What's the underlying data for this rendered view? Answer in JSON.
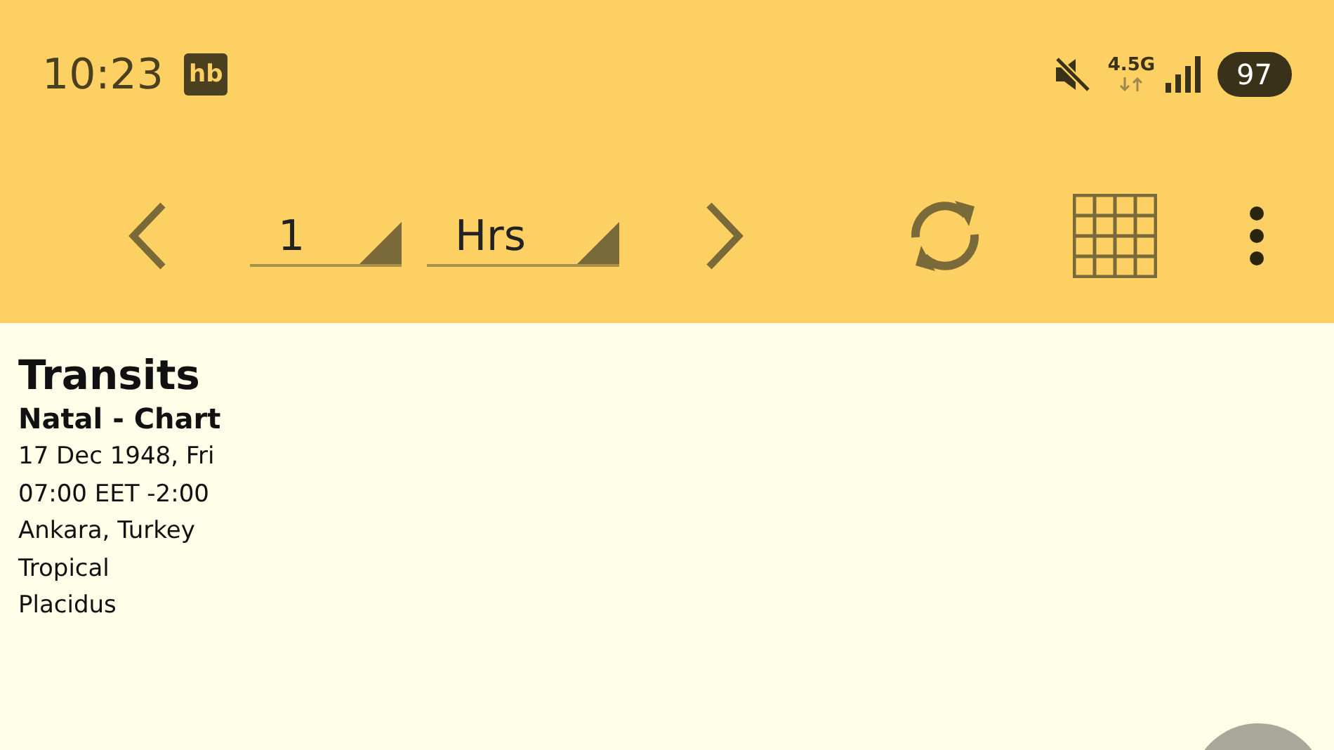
{
  "status_bar": {
    "time": "10:23",
    "app_badge": "hb",
    "network": "4.5G",
    "battery": "97"
  },
  "toolbar": {
    "step_value": "1",
    "step_unit": "Hrs"
  },
  "chart_info": {
    "title": "Transits",
    "subtitle": "Natal - Chart",
    "lines": [
      "17 Dec 1948, Fri",
      "07:00 EET -2:00",
      "Ankara, Turkey",
      "Tropical",
      "Placidus"
    ]
  }
}
